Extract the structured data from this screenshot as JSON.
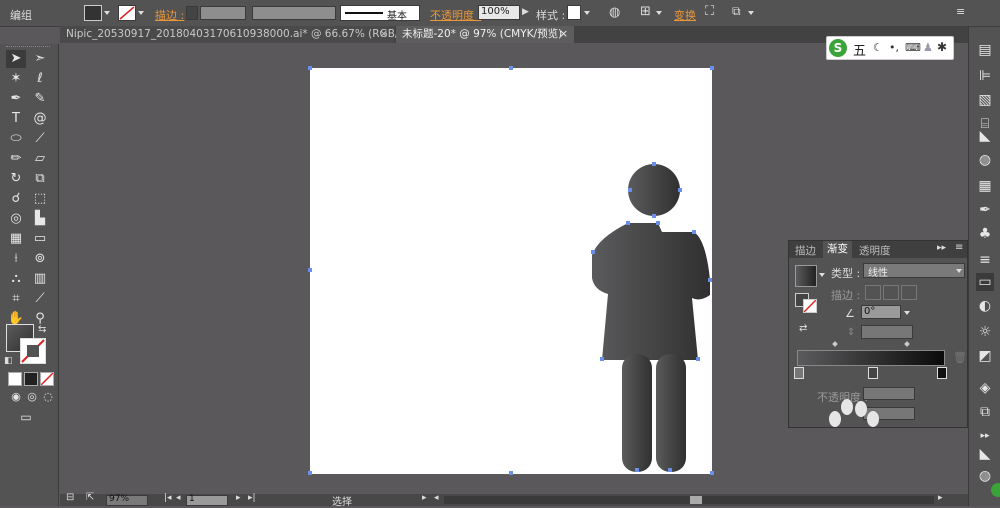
{
  "control_bar": {
    "selection_label": "编组",
    "stroke_label": "描边 :",
    "stroke_style_label": "基本",
    "opacity_label": "不透明度 :",
    "opacity_value": "100%",
    "style_label": "样式 :",
    "transform_label": "变换"
  },
  "tabs": [
    {
      "label": "Nipic_20530917_20180403170610938000.ai* @ 66.67% (RGB/预览)",
      "close": "×"
    },
    {
      "label": "未标题-20* @ 97% (CMYK/预览)",
      "close": "×"
    }
  ],
  "gradient_panel": {
    "tabs": [
      "描边",
      "渐变",
      "透明度"
    ],
    "type_label": "类型 :",
    "type_value": "线性",
    "stroke_label": "描边 :",
    "angle_value": "0°",
    "opacity_label": "不透明度 :"
  },
  "status_bar": {
    "zoom_value": "97%",
    "artboard_value": "1",
    "tool_label": "选择"
  },
  "ime_bar": {
    "logo_letter": "S",
    "mode_label": "五"
  },
  "colors": {
    "accent_orange": "#e9983a",
    "figure_gradient_start": "#5b5b5d",
    "figure_gradient_end": "#303030",
    "anchor_blue": "#6a8fe8"
  }
}
